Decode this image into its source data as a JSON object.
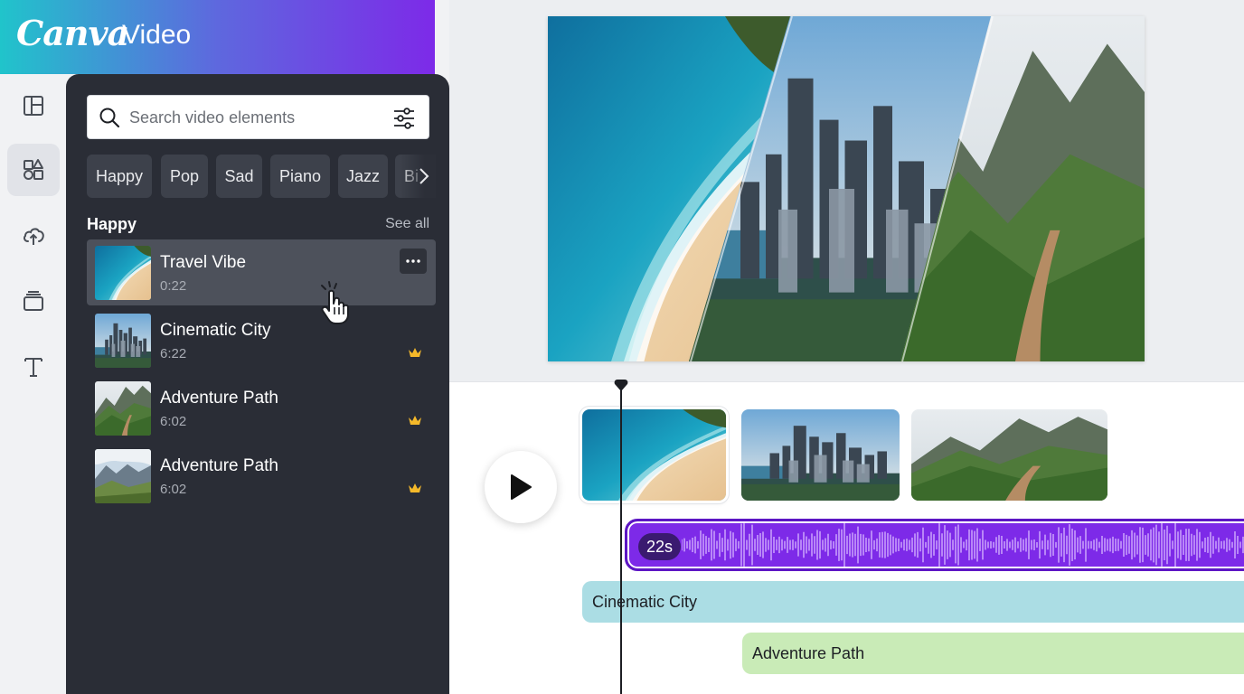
{
  "brand": {
    "logo": "Canva",
    "product": "Video",
    "colors": {
      "start": "#20c4cb",
      "end": "#7d2ae8"
    }
  },
  "rail": {
    "items": [
      {
        "icon": "layout-icon",
        "active": false
      },
      {
        "icon": "elements-icon",
        "active": true
      },
      {
        "icon": "upload-cloud-icon",
        "active": false
      },
      {
        "icon": "projects-icon",
        "active": false
      },
      {
        "icon": "text-icon",
        "active": false
      }
    ]
  },
  "panel": {
    "search": {
      "placeholder": "Search video elements",
      "value": ""
    },
    "chips": [
      "Happy",
      "Pop",
      "Sad",
      "Piano",
      "Jazz",
      "Bi"
    ],
    "section": {
      "title": "Happy",
      "see_all": "See all"
    },
    "items": [
      {
        "title": "Travel Vibe",
        "duration": "0:22",
        "thumb": "beach",
        "premium": false,
        "hovered": true
      },
      {
        "title": "Cinematic City",
        "duration": "6:22",
        "thumb": "city",
        "premium": true,
        "hovered": false
      },
      {
        "title": "Adventure Path",
        "duration": "6:02",
        "thumb": "mountain",
        "premium": true,
        "hovered": false
      },
      {
        "title": "Adventure Path",
        "duration": "6:02",
        "thumb": "valley",
        "premium": true,
        "hovered": false
      }
    ]
  },
  "timeline": {
    "audio": {
      "badge": "22s",
      "color": "#7d2ae8"
    },
    "tracks": [
      {
        "label": "Cinematic City",
        "color": "#abdde4"
      },
      {
        "label": "Adventure Path",
        "color": "#c9ebb7"
      }
    ],
    "clips": [
      "beach",
      "city",
      "mountain"
    ]
  }
}
